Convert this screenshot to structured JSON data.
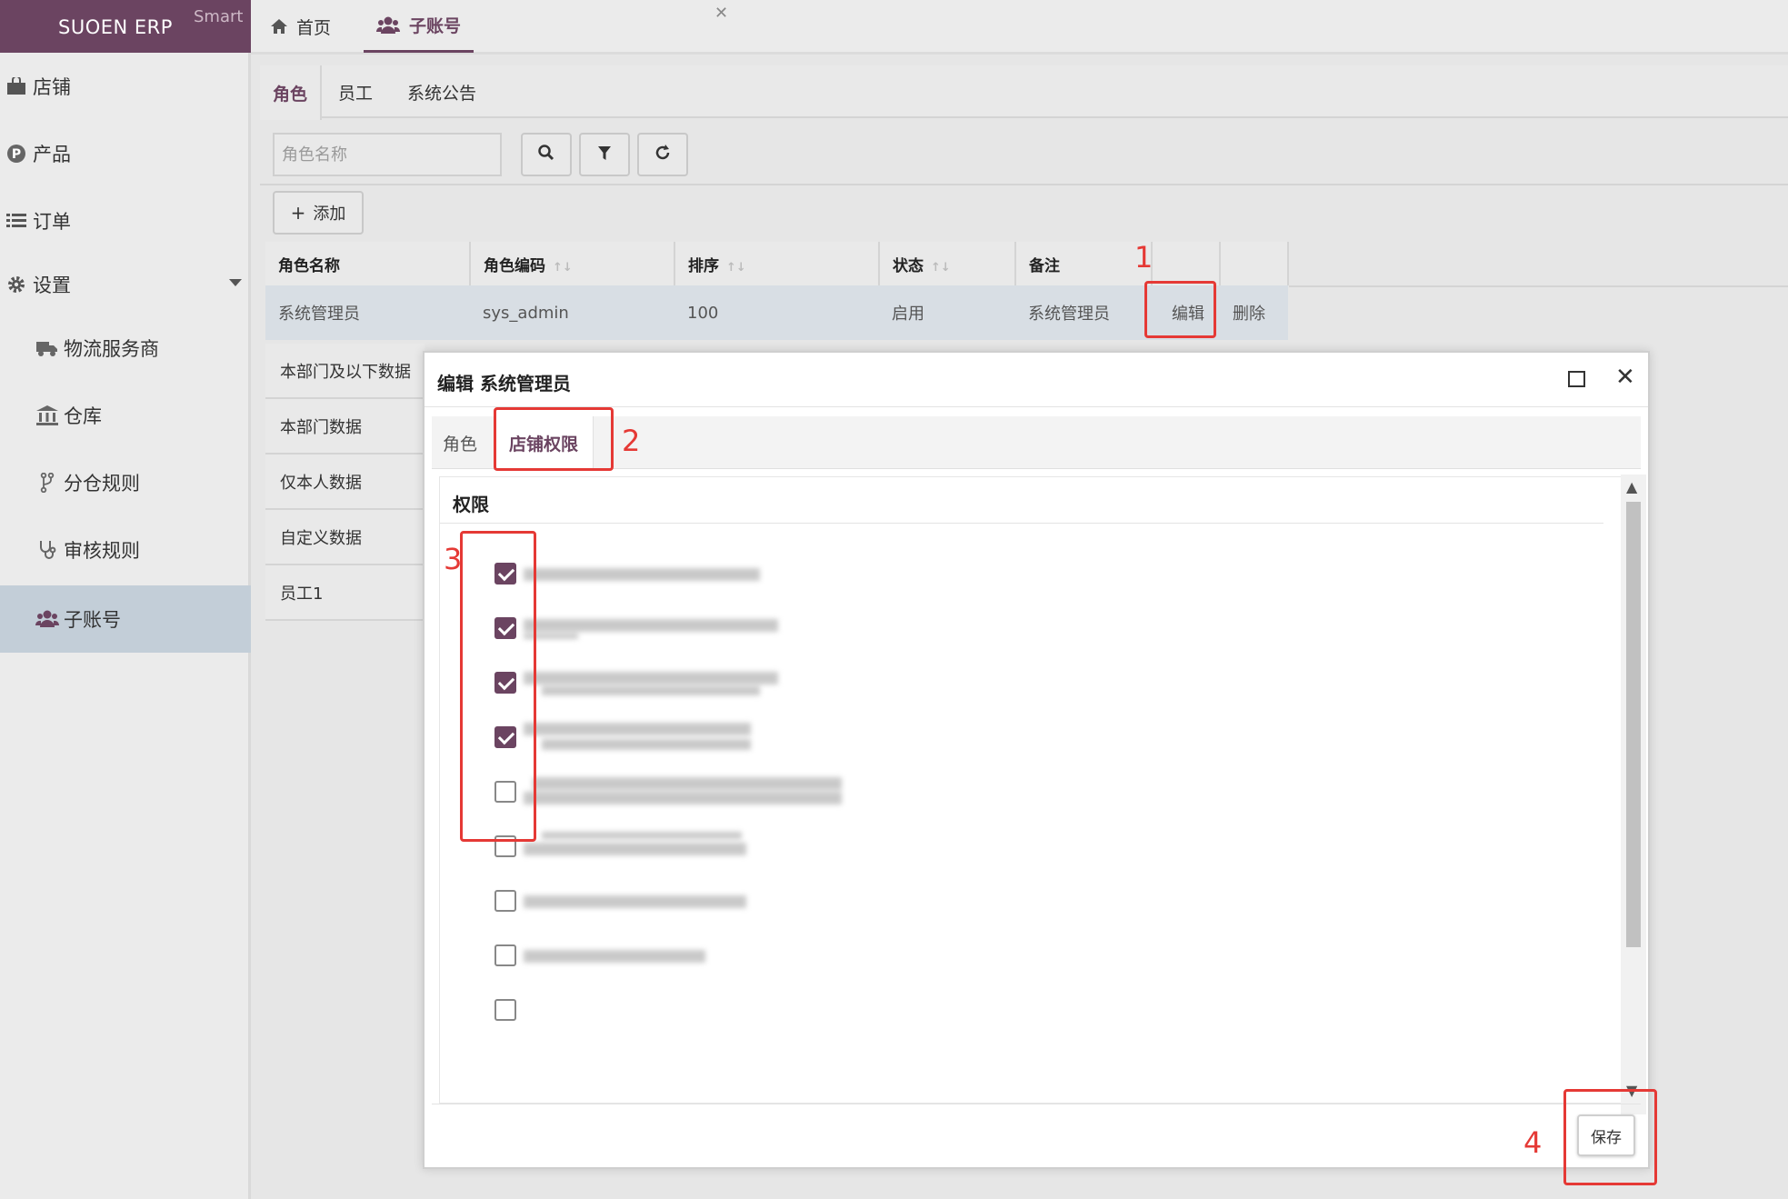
{
  "brand": {
    "title": "SUOEN ERP",
    "tag": "Smart"
  },
  "sidebar": {
    "items": [
      {
        "label": "店铺",
        "icon": "shopping-bag-icon"
      },
      {
        "label": "产品",
        "icon": "product-p-icon"
      },
      {
        "label": "订单",
        "icon": "list-icon"
      },
      {
        "label": "设置",
        "icon": "gear-icon"
      },
      {
        "label": "物流服务商",
        "icon": "truck-icon"
      },
      {
        "label": "仓库",
        "icon": "bank-icon"
      },
      {
        "label": "分仓规则",
        "icon": "code-fork-icon"
      },
      {
        "label": "审核规则",
        "icon": "stethoscope-icon"
      },
      {
        "label": "子账号",
        "icon": "users-icon"
      }
    ]
  },
  "top_tabs": [
    {
      "label": "首页",
      "icon": "home-icon"
    },
    {
      "label": "子账号",
      "icon": "users-icon"
    }
  ],
  "sub_tabs": [
    "角色",
    "员工",
    "系统公告"
  ],
  "search": {
    "placeholder": "角色名称"
  },
  "toolbar": {
    "add_label": "添加"
  },
  "table": {
    "headers": [
      "角色名称",
      "角色编码",
      "排序",
      "状态",
      "备注"
    ],
    "row": {
      "name": "系统管理员",
      "code": "sys_admin",
      "order": "100",
      "status": "启用",
      "remark": "系统管理员",
      "edit": "编辑",
      "delete": "删除"
    }
  },
  "role_list": [
    "本部门及以下数据",
    "本部门数据",
    "仅本人数据",
    "自定义数据",
    "员工1"
  ],
  "modal": {
    "title": "编辑 系统管理员",
    "tabs": [
      "角色",
      "店铺权限"
    ],
    "section_title": "权限",
    "checkboxes": [
      true,
      true,
      true,
      true,
      false,
      false,
      false,
      false
    ],
    "save_label": "保存"
  },
  "annotations": [
    "1",
    "2",
    "3",
    "4"
  ],
  "colors": {
    "brand": "#6b4461",
    "annotation": "#e53935",
    "row_highlight": "#d8dee4"
  }
}
